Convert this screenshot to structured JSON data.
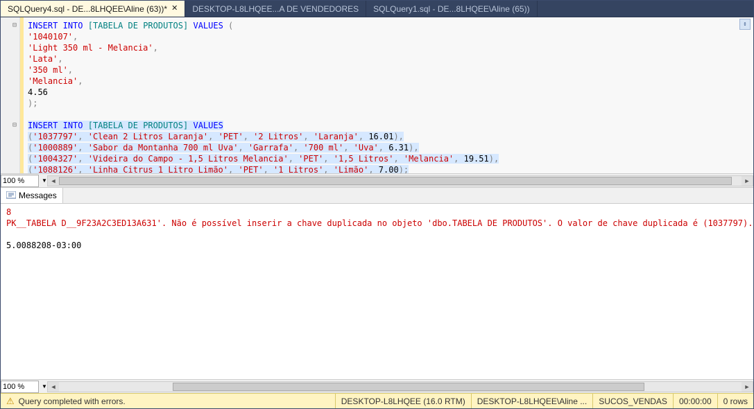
{
  "tabs": [
    {
      "label": "SQLQuery4.sql - DE...8LHQEE\\Aline (63))*",
      "active": true,
      "closable": true
    },
    {
      "label": "DESKTOP-L8LHQEE...A DE VENDEDORES",
      "active": false,
      "closable": false
    },
    {
      "label": "SQLQuery1.sql - DE...8LHQEE\\Aline (65))",
      "active": false,
      "closable": false
    }
  ],
  "code": {
    "l1": {
      "kw1": "INSERT",
      "kw2": "INTO",
      "obj": "[TABELA DE PRODUTOS]",
      "kw3": "VALUES",
      "paren": " ("
    },
    "l2": "'1040107'",
    "l3": "'Light 350 ml - Melancia'",
    "l4": "'Lata'",
    "l5": "'350 ml'",
    "l6": "'Melancia'",
    "l7": "4.56",
    "l8": ");",
    "l10": {
      "kw1": "INSERT",
      "kw2": "INTO",
      "obj": "[TABELA DE PRODUTOS]",
      "kw3": "VALUES"
    },
    "r1": {
      "a": "'1037797'",
      "b": "'Clean 2 Litros Laranja'",
      "c": "'PET'",
      "d": "'2 Litros'",
      "e": "'Laranja'",
      "f": "16.01"
    },
    "r2": {
      "a": "'1000889'",
      "b": "'Sabor da Montanha 700 ml Uva'",
      "c": "'Garrafa'",
      "d": "'700 ml'",
      "e": "'Uva'",
      "f": "6.31"
    },
    "r3": {
      "a": "'1004327'",
      "b": "'Videira do Campo - 1,5 Litros Melancia'",
      "c": "'PET'",
      "d": "'1,5 Litros'",
      "e": "'Melancia'",
      "f": "19.51"
    },
    "r4": {
      "a": "'1088126'",
      "b": "'Linha Citrus 1 Litro Limão'",
      "c": "'PET'",
      "d": "'1 Litros'",
      "e": "'Limão'",
      "f": "7.00"
    }
  },
  "zoom1": "100 %",
  "zoom2": "100 %",
  "messages": {
    "tab": "Messages",
    "line1": "8",
    "line2": "PK__TABELA D__9F23A2C3ED13A631'. Não é possível inserir a chave duplicada no objeto 'dbo.TABELA DE PRODUTOS'. O valor de chave duplicada é (1037797).",
    "line3": "5.0088208-03:00"
  },
  "status": {
    "msg": "Query completed with errors.",
    "server": "DESKTOP-L8LHQEE (16.0 RTM)",
    "user": "DESKTOP-L8LHQEE\\Aline ...",
    "db": "SUCOS_VENDAS",
    "time": "00:00:00",
    "rows": "0 rows"
  }
}
